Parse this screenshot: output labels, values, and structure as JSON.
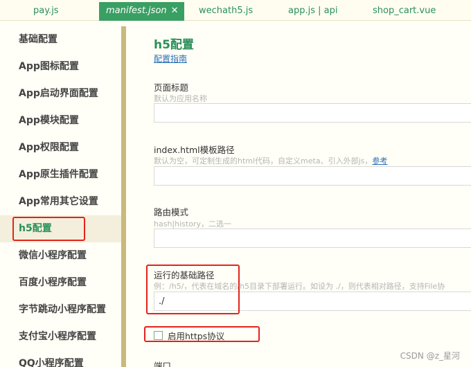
{
  "tabs": [
    {
      "label": "pay.js"
    },
    {
      "label": "manifest.json",
      "close": "✕"
    },
    {
      "label": "wechath5.js"
    },
    {
      "label": "app.js | api"
    },
    {
      "label": "shop_cart.vue"
    }
  ],
  "sidebar": {
    "items": [
      {
        "label": "基础配置"
      },
      {
        "label": "App图标配置"
      },
      {
        "label": "App启动界面配置"
      },
      {
        "label": "App模块配置"
      },
      {
        "label": "App权限配置"
      },
      {
        "label": "App原生插件配置"
      },
      {
        "label": "App常用其它设置"
      },
      {
        "label": "h5配置"
      },
      {
        "label": "微信小程序配置"
      },
      {
        "label": "百度小程序配置"
      },
      {
        "label": "字节跳动小程序配置"
      },
      {
        "label": "支付宝小程序配置"
      },
      {
        "label": "QQ小程序配置"
      }
    ]
  },
  "main": {
    "title": "h5配置",
    "guide_link": "配置指南",
    "fields": [
      {
        "label": "页面标题",
        "hint": "默认为应用名称",
        "value": ""
      },
      {
        "label": "index.html模板路径",
        "hint": "默认为空，可定制生成的html代码，自定义meta、引入外部js，",
        "hint_link": "参考",
        "value": ""
      },
      {
        "label": "路由模式",
        "hint": "hash|history，二选一",
        "value": ""
      },
      {
        "label": "运行的基础路径",
        "hint": "例：/h5/，代表在域名的/h5目录下部署运行。如设为 ./，则代表相对路径，支持File协",
        "value": "./"
      }
    ],
    "https_checkbox": {
      "label": "启用https协议",
      "checked": false
    },
    "port_label": "端口"
  },
  "watermark": "CSDN @z_星河",
  "colors": {
    "accent": "#2a8f59",
    "active_tab_bg": "#3a9f63",
    "divider": "#c9b97a",
    "highlight_box": "#e2231a",
    "link": "#2a6fb5"
  }
}
